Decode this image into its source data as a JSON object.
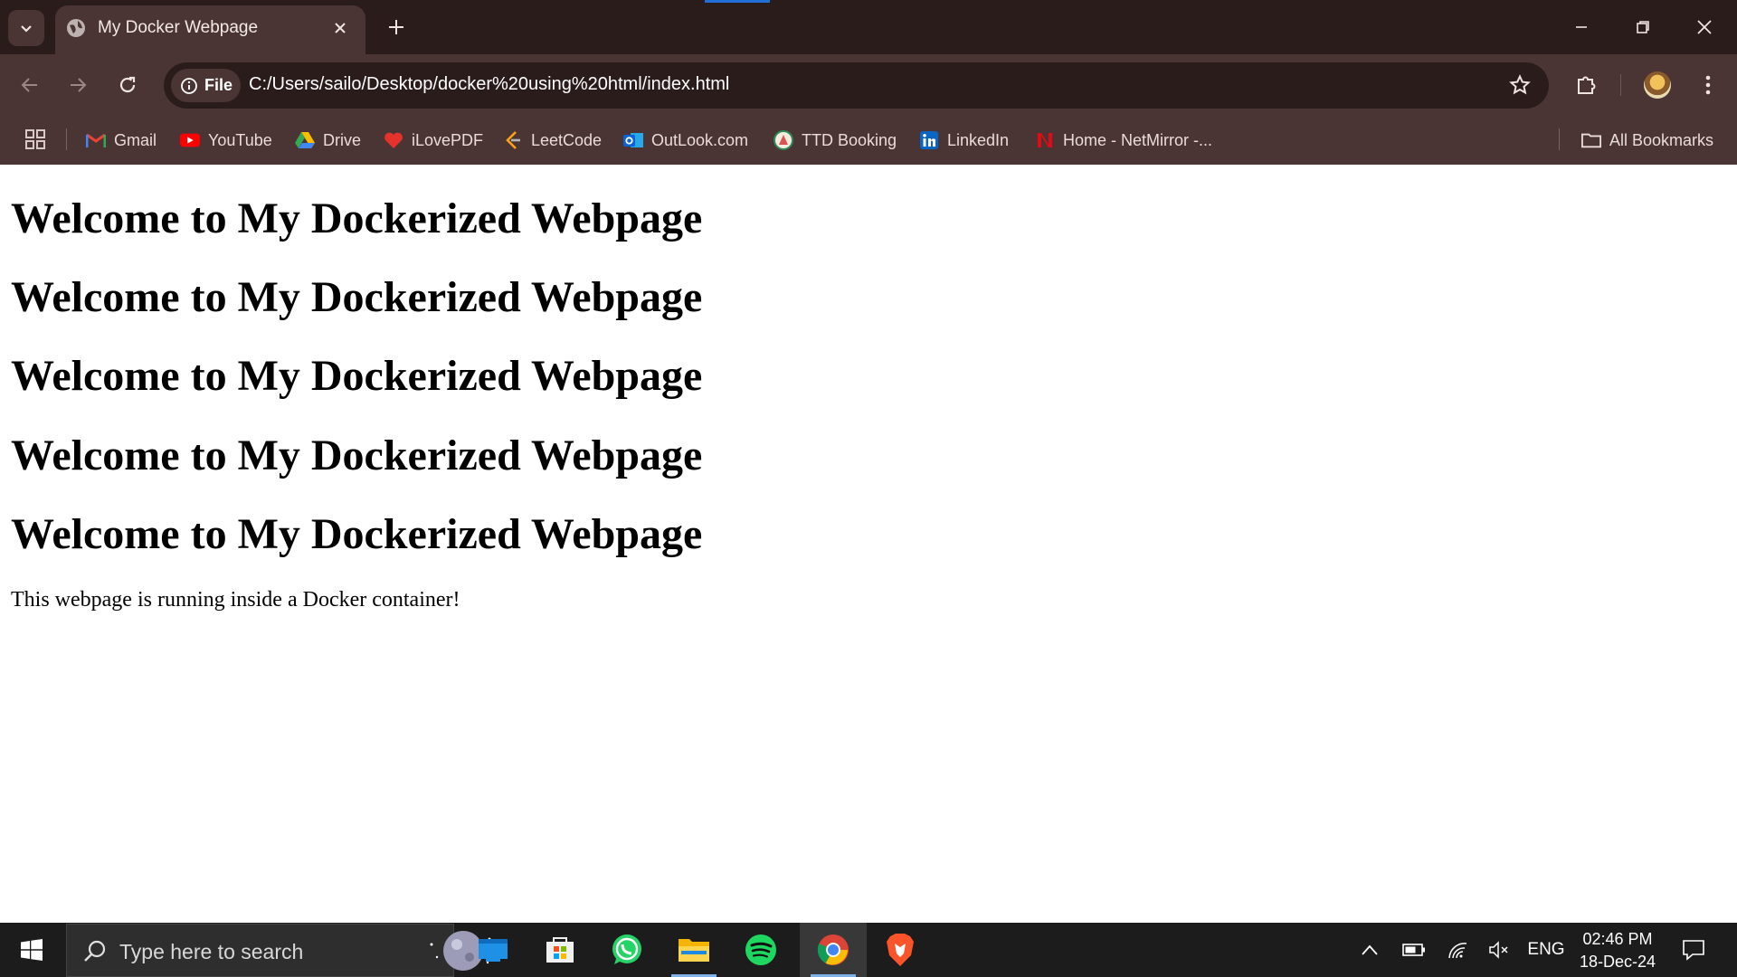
{
  "browser": {
    "tab": {
      "title": "My Docker Webpage"
    },
    "omnibox": {
      "chip_label": "File",
      "url": "C:/Users/sailo/Desktop/docker%20using%20html/index.html"
    },
    "bookmarks": [
      {
        "label": "Gmail",
        "icon": "gmail-icon"
      },
      {
        "label": "YouTube",
        "icon": "youtube-icon"
      },
      {
        "label": "Drive",
        "icon": "drive-icon"
      },
      {
        "label": "iLovePDF",
        "icon": "ilovepdf-icon"
      },
      {
        "label": "LeetCode",
        "icon": "leetcode-icon"
      },
      {
        "label": "OutLook.com",
        "icon": "outlook-icon"
      },
      {
        "label": "TTD Booking",
        "icon": "ttd-icon"
      },
      {
        "label": "LinkedIn",
        "icon": "linkedin-icon"
      },
      {
        "label": "Home - NetMirror -...",
        "icon": "netmirror-icon"
      }
    ],
    "all_bookmarks_label": "All Bookmarks",
    "theme": {
      "frame": "#2b1c1c",
      "toolbar": "#4a3434",
      "accent": "#1f6fd6"
    }
  },
  "page": {
    "headings": [
      "Welcome to My Dockerized Webpage",
      "Welcome to My Dockerized Webpage",
      "Welcome to My Dockerized Webpage",
      "Welcome to My Dockerized Webpage",
      "Welcome to My Dockerized Webpage"
    ],
    "paragraph": "This webpage is running inside a Docker container!"
  },
  "taskbar": {
    "search_placeholder": "Type here to search",
    "apps": [
      "task-view-icon",
      "microsoft-store-icon",
      "whatsapp-icon",
      "file-explorer-icon",
      "spotify-icon",
      "chrome-icon",
      "brave-icon"
    ],
    "tray": {
      "language": "ENG",
      "time": "02:46 PM",
      "date": "18-Dec-24"
    }
  }
}
